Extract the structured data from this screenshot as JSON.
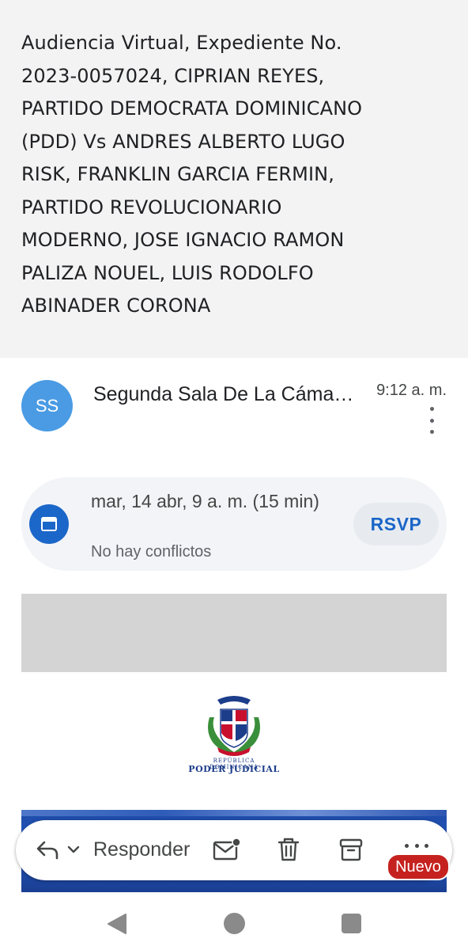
{
  "email": {
    "subject": "Audiencia Virtual, Expediente No.\n2023-0057024,  CIPRIAN REYES,\nPARTIDO DEMOCRATA DOMINICANO\n(PDD) Vs  ANDRES ALBERTO LUGO\nRISK, FRANKLIN GARCIA FERMIN,\nPARTIDO REVOLUCIONARIO\nMODERNO, JOSE IGNACIO RAMON\nPALIZA NOUEL, LUIS RODOLFO\nABINADER CORONA"
  },
  "sender": {
    "initials": "SS",
    "name": "Segunda Sala De La Cámara Penal",
    "time": "9:12 a. m.",
    "avatar_color": "#4a9be4"
  },
  "event": {
    "when": "mar, 14 abr, 9 a. m. (15 min)",
    "conflicts": "No hay conflictos",
    "rsvp_label": "RSVP",
    "icon": "calendar-icon"
  },
  "body": {
    "logo_line1": "REPÚBLICA DOMINICANA",
    "logo_line2": "PODER JUDICIAL"
  },
  "toolbar": {
    "reply_label": "Responder",
    "new_badge": "Nuevo",
    "icons": [
      "reply-icon",
      "chevron-down-icon",
      "mark-unread-icon",
      "trash-icon",
      "archive-icon",
      "more-horizontal-icon"
    ]
  },
  "navbar": {
    "icons": [
      "back-icon",
      "home-icon",
      "recents-icon"
    ]
  }
}
